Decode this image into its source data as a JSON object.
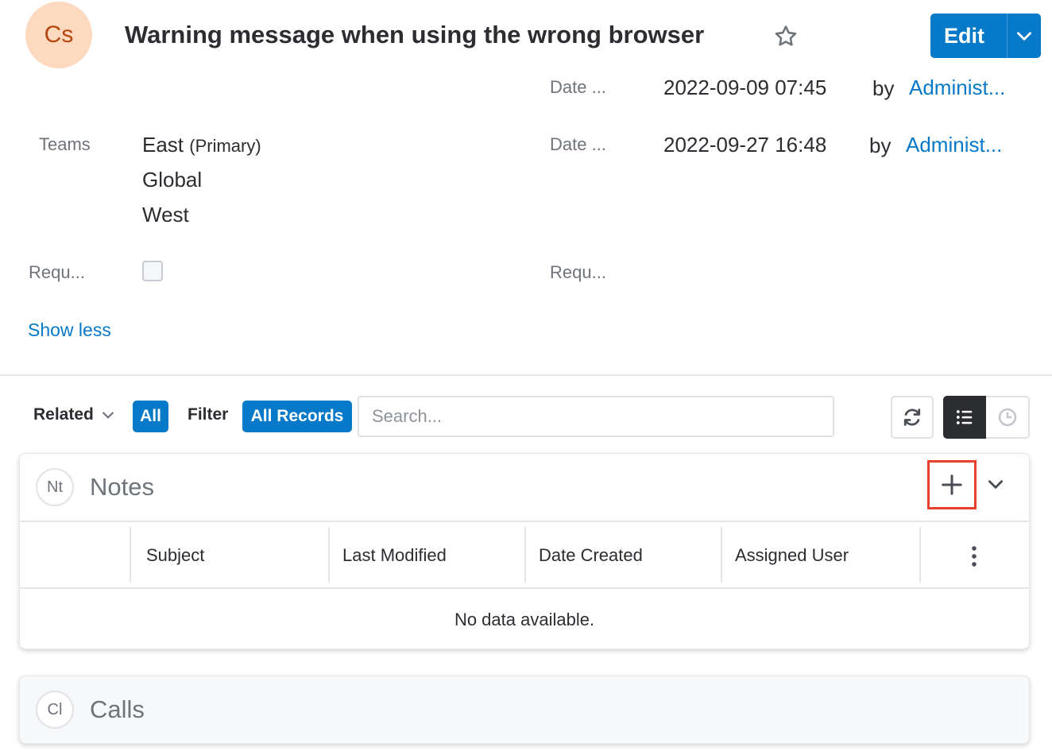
{
  "header": {
    "avatar_initials": "Cs",
    "title": "Warning message when using the wrong browser",
    "edit_label": "Edit"
  },
  "fields": {
    "date_created_label": "Date ...",
    "date_created_value": "2022-09-09 07:45",
    "date_created_by": "by",
    "date_created_user": "Administ...",
    "date_modified_label": "Date ...",
    "date_modified_value": "2022-09-27 16:48",
    "date_modified_by": "by",
    "date_modified_user": "Administ...",
    "teams_label": "Teams",
    "teams": [
      {
        "name": "East",
        "suffix": "(Primary)"
      },
      {
        "name": "Global"
      },
      {
        "name": "West"
      }
    ],
    "req_left_label": "Requ...",
    "req_left_checked": false,
    "req_right_label": "Requ...",
    "show_less": "Show less"
  },
  "related_bar": {
    "related_label": "Related",
    "all_label": "All",
    "filter_label": "Filter",
    "all_records_label": "All Records",
    "search_placeholder": "Search..."
  },
  "notes_panel": {
    "icon_initials": "Nt",
    "title": "Notes",
    "columns": [
      "Subject",
      "Last Modified",
      "Date Created",
      "Assigned User"
    ],
    "empty_message": "No data available."
  },
  "calls_panel": {
    "icon_initials": "Cl",
    "title": "Calls"
  },
  "colors": {
    "accent": "#0679c8",
    "highlight": "#e8412c",
    "avatar_bg": "#fcd9bf"
  }
}
